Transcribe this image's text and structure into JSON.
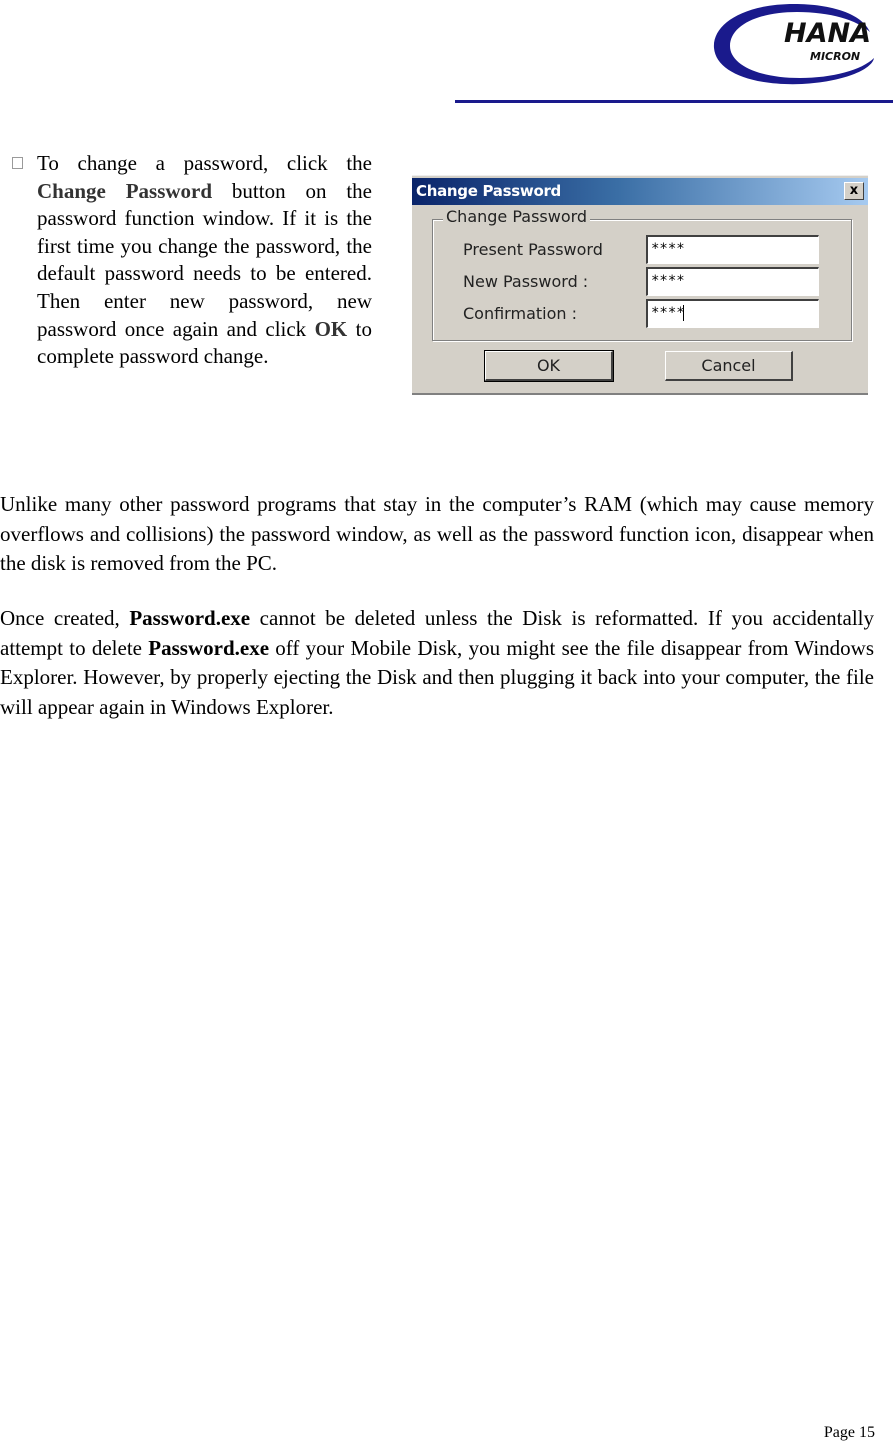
{
  "header": {
    "logo": {
      "text_main": "HANA",
      "text_sub": "MICRON",
      "color_ring": "#1a1a8c",
      "icon": "hana-micron-logo"
    },
    "rule_color": "#1a1a8c"
  },
  "bullet": {
    "icon": "bullet-box-icon",
    "parts": [
      {
        "text": "To change a password, click the ",
        "bold": false
      },
      {
        "text": "Change Password",
        "bold": true
      },
      {
        "text": " button on the password function window.  If it is the first time you change the password, the default password needs to be entered.  Then enter new password, new password once again and click ",
        "bold": false
      },
      {
        "text": "OK",
        "bold": true
      },
      {
        "text": " to complete password change.",
        "bold": false
      }
    ]
  },
  "dialog": {
    "title": "Change Password",
    "close_label": "x",
    "group_label": "Change Password",
    "fields": [
      {
        "label": "Present Password",
        "value": "****"
      },
      {
        "label": "New Password :",
        "value": "****"
      },
      {
        "label": "Confirmation :",
        "value": "****"
      }
    ],
    "ok_label": "OK",
    "cancel_label": "Cancel"
  },
  "paragraphs": [
    {
      "parts": [
        {
          "text": "Unlike many other password programs that stay in the computer’s RAM (which may cause memory overflows and collisions) the password window, as well as the password function icon, disappear when the disk is removed from the PC.",
          "bold": false
        }
      ]
    },
    {
      "parts": [
        {
          "text": "Once created, ",
          "bold": false
        },
        {
          "text": "Password.exe",
          "bold": true
        },
        {
          "text": " cannot be deleted unless the Disk is reformatted.  If you accidentally attempt to delete ",
          "bold": false
        },
        {
          "text": "Password.exe",
          "bold": true
        },
        {
          "text": " off your Mobile Disk, you might see the file disappear from Windows Explorer.  However, by properly ejecting the Disk and then plugging it back into your computer, the file will appear again in Windows Explorer.",
          "bold": false
        }
      ]
    }
  ],
  "footer": {
    "page_label": "Page 15"
  }
}
